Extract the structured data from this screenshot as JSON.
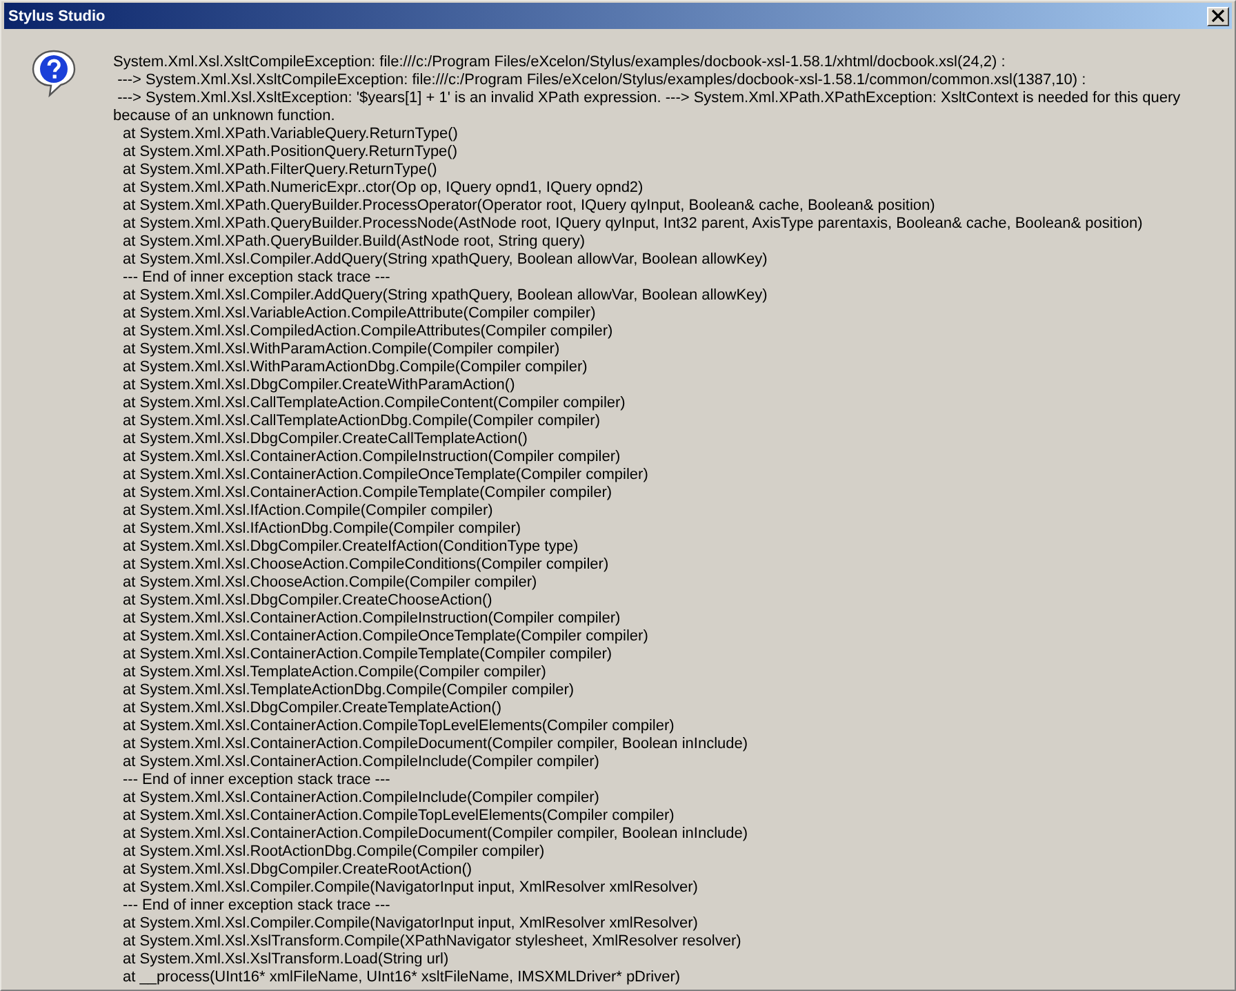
{
  "window": {
    "title": "Stylus Studio"
  },
  "message": [
    {
      "kind": "message",
      "text": "System.Xml.Xsl.XsltCompileException: file:///c:/Program Files/eXcelon/Stylus/examples/docbook-xsl-1.58.1/xhtml/docbook.xsl(24,2) :"
    },
    {
      "kind": "message",
      "text": " ---> System.Xml.Xsl.XsltCompileException: file:///c:/Program Files/eXcelon/Stylus/examples/docbook-xsl-1.58.1/common/common.xsl(1387,10) :"
    },
    {
      "kind": "message",
      "text": " ---> System.Xml.Xsl.XsltException: '$years[1] + 1' is an invalid XPath expression. ---> System.Xml.XPath.XPathException: XsltContext is needed for this query because of an unknown function."
    },
    {
      "kind": "trace",
      "text": "at System.Xml.XPath.VariableQuery.ReturnType()"
    },
    {
      "kind": "trace",
      "text": "at System.Xml.XPath.PositionQuery.ReturnType()"
    },
    {
      "kind": "trace",
      "text": "at System.Xml.XPath.FilterQuery.ReturnType()"
    },
    {
      "kind": "trace",
      "text": "at System.Xml.XPath.NumericExpr..ctor(Op op, IQuery opnd1, IQuery opnd2)"
    },
    {
      "kind": "trace",
      "text": "at System.Xml.XPath.QueryBuilder.ProcessOperator(Operator root, IQuery qyInput, Boolean& cache, Boolean& position)"
    },
    {
      "kind": "trace",
      "text": "at System.Xml.XPath.QueryBuilder.ProcessNode(AstNode root, IQuery qyInput, Int32 parent, AxisType parentaxis, Boolean& cache, Boolean& position)"
    },
    {
      "kind": "trace",
      "text": "at System.Xml.XPath.QueryBuilder.Build(AstNode root, String query)"
    },
    {
      "kind": "trace",
      "text": "at System.Xml.Xsl.Compiler.AddQuery(String xpathQuery, Boolean allowVar, Boolean allowKey)"
    },
    {
      "kind": "trace",
      "text": "--- End of inner exception stack trace ---"
    },
    {
      "kind": "trace",
      "text": "at System.Xml.Xsl.Compiler.AddQuery(String xpathQuery, Boolean allowVar, Boolean allowKey)"
    },
    {
      "kind": "trace",
      "text": "at System.Xml.Xsl.VariableAction.CompileAttribute(Compiler compiler)"
    },
    {
      "kind": "trace",
      "text": "at System.Xml.Xsl.CompiledAction.CompileAttributes(Compiler compiler)"
    },
    {
      "kind": "trace",
      "text": "at System.Xml.Xsl.WithParamAction.Compile(Compiler compiler)"
    },
    {
      "kind": "trace",
      "text": "at System.Xml.Xsl.WithParamActionDbg.Compile(Compiler compiler)"
    },
    {
      "kind": "trace",
      "text": "at System.Xml.Xsl.DbgCompiler.CreateWithParamAction()"
    },
    {
      "kind": "trace",
      "text": "at System.Xml.Xsl.CallTemplateAction.CompileContent(Compiler compiler)"
    },
    {
      "kind": "trace",
      "text": "at System.Xml.Xsl.CallTemplateActionDbg.Compile(Compiler compiler)"
    },
    {
      "kind": "trace",
      "text": "at System.Xml.Xsl.DbgCompiler.CreateCallTemplateAction()"
    },
    {
      "kind": "trace",
      "text": "at System.Xml.Xsl.ContainerAction.CompileInstruction(Compiler compiler)"
    },
    {
      "kind": "trace",
      "text": "at System.Xml.Xsl.ContainerAction.CompileOnceTemplate(Compiler compiler)"
    },
    {
      "kind": "trace",
      "text": "at System.Xml.Xsl.ContainerAction.CompileTemplate(Compiler compiler)"
    },
    {
      "kind": "trace",
      "text": "at System.Xml.Xsl.IfAction.Compile(Compiler compiler)"
    },
    {
      "kind": "trace",
      "text": "at System.Xml.Xsl.IfActionDbg.Compile(Compiler compiler)"
    },
    {
      "kind": "trace",
      "text": "at System.Xml.Xsl.DbgCompiler.CreateIfAction(ConditionType type)"
    },
    {
      "kind": "trace",
      "text": "at System.Xml.Xsl.ChooseAction.CompileConditions(Compiler compiler)"
    },
    {
      "kind": "trace",
      "text": "at System.Xml.Xsl.ChooseAction.Compile(Compiler compiler)"
    },
    {
      "kind": "trace",
      "text": "at System.Xml.Xsl.DbgCompiler.CreateChooseAction()"
    },
    {
      "kind": "trace",
      "text": "at System.Xml.Xsl.ContainerAction.CompileInstruction(Compiler compiler)"
    },
    {
      "kind": "trace",
      "text": "at System.Xml.Xsl.ContainerAction.CompileOnceTemplate(Compiler compiler)"
    },
    {
      "kind": "trace",
      "text": "at System.Xml.Xsl.ContainerAction.CompileTemplate(Compiler compiler)"
    },
    {
      "kind": "trace",
      "text": "at System.Xml.Xsl.TemplateAction.Compile(Compiler compiler)"
    },
    {
      "kind": "trace",
      "text": "at System.Xml.Xsl.TemplateActionDbg.Compile(Compiler compiler)"
    },
    {
      "kind": "trace",
      "text": "at System.Xml.Xsl.DbgCompiler.CreateTemplateAction()"
    },
    {
      "kind": "trace",
      "text": "at System.Xml.Xsl.ContainerAction.CompileTopLevelElements(Compiler compiler)"
    },
    {
      "kind": "trace",
      "text": "at System.Xml.Xsl.ContainerAction.CompileDocument(Compiler compiler, Boolean inInclude)"
    },
    {
      "kind": "trace",
      "text": "at System.Xml.Xsl.ContainerAction.CompileInclude(Compiler compiler)"
    },
    {
      "kind": "trace",
      "text": "--- End of inner exception stack trace ---"
    },
    {
      "kind": "trace",
      "text": "at System.Xml.Xsl.ContainerAction.CompileInclude(Compiler compiler)"
    },
    {
      "kind": "trace",
      "text": "at System.Xml.Xsl.ContainerAction.CompileTopLevelElements(Compiler compiler)"
    },
    {
      "kind": "trace",
      "text": "at System.Xml.Xsl.ContainerAction.CompileDocument(Compiler compiler, Boolean inInclude)"
    },
    {
      "kind": "trace",
      "text": "at System.Xml.Xsl.RootActionDbg.Compile(Compiler compiler)"
    },
    {
      "kind": "trace",
      "text": "at System.Xml.Xsl.DbgCompiler.CreateRootAction()"
    },
    {
      "kind": "trace",
      "text": "at System.Xml.Xsl.Compiler.Compile(NavigatorInput input, XmlResolver xmlResolver)"
    },
    {
      "kind": "trace",
      "text": "--- End of inner exception stack trace ---"
    },
    {
      "kind": "trace",
      "text": "at System.Xml.Xsl.Compiler.Compile(NavigatorInput input, XmlResolver xmlResolver)"
    },
    {
      "kind": "trace",
      "text": "at System.Xml.Xsl.XslTransform.Compile(XPathNavigator stylesheet, XmlResolver resolver)"
    },
    {
      "kind": "trace",
      "text": "at System.Xml.Xsl.XslTransform.Load(String url)"
    },
    {
      "kind": "trace",
      "text": "at __process(UInt16* xmlFileName, UInt16* xsltFileName, IMSXMLDriver* pDriver)"
    }
  ]
}
